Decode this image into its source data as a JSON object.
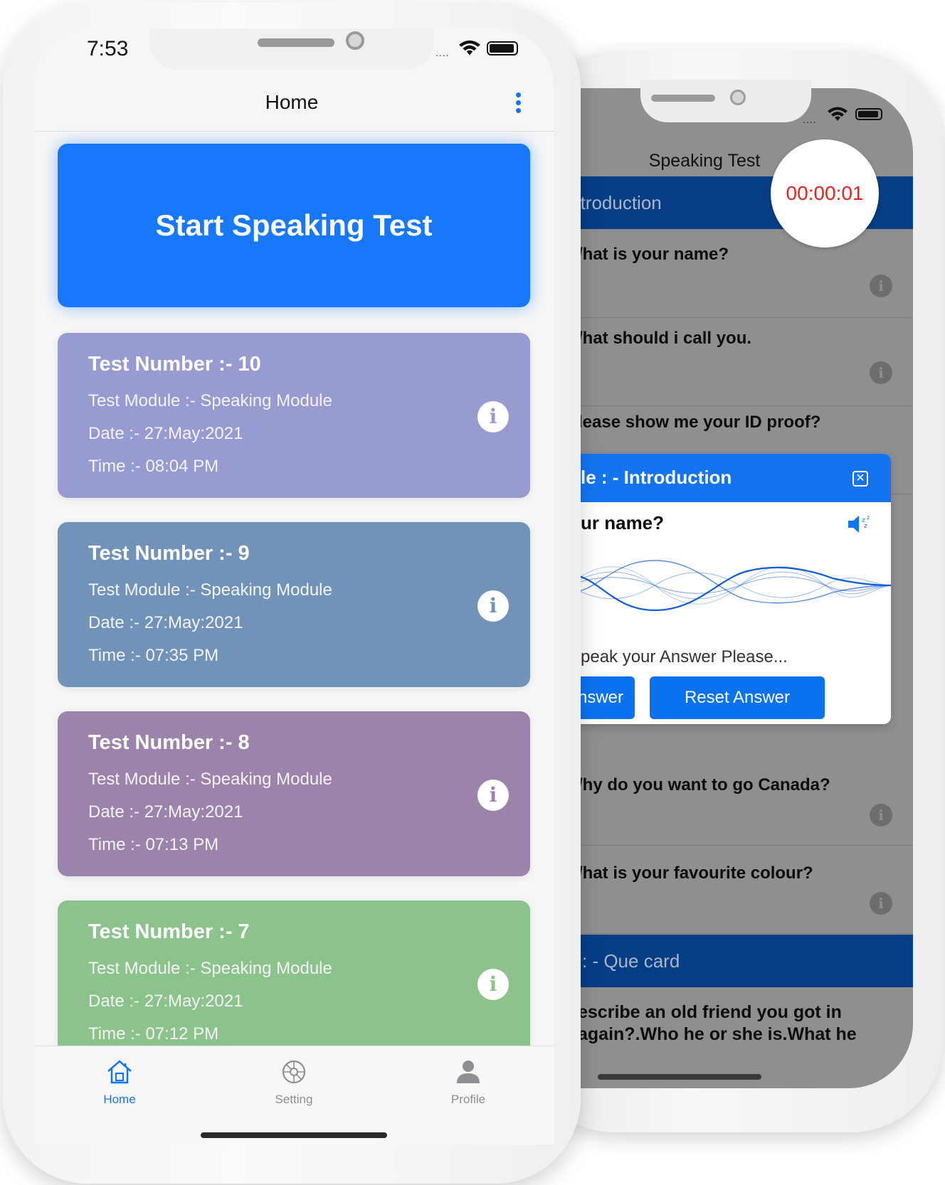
{
  "back_phone": {
    "title": "Speaking Test",
    "timer": "00:00:01",
    "sections": [
      {
        "label": "- Introduction"
      },
      {
        "label": ": - Que card"
      }
    ],
    "questions": [
      {
        "text": "/hat is your name?"
      },
      {
        "text": "/hat should i call you."
      },
      {
        "text": "lease show me your ID proof?"
      },
      {
        "text": "/hy do you want to go Canada?"
      },
      {
        "text": "/hat is your favourite colour?"
      }
    ],
    "long_question": "escribe an old friend you got in again?.Who he or she is.What he",
    "modal": {
      "title": "le : - Introduction",
      "question": "ur name?",
      "hint": "peak your Answer Please...",
      "answer_button": "Answer",
      "reset_button": "Reset Answer"
    }
  },
  "front_phone": {
    "status_time": "7:53",
    "nav_title": "Home",
    "start_button": "Start Speaking Test",
    "tests": [
      {
        "number": "Test Number :- 10",
        "module": "Test Module :- Speaking Module",
        "date": "Date :- 27:May:2021",
        "time": "Time :- 08:04 PM",
        "color": "#979bd1"
      },
      {
        "number": "Test Number :- 9",
        "module": "Test Module :- Speaking Module",
        "date": "Date :- 27:May:2021",
        "time": "Time :- 07:35 PM",
        "color": "#7193b9"
      },
      {
        "number": "Test Number :- 8",
        "module": "Test Module :- Speaking Module",
        "date": "Date :- 27:May:2021",
        "time": "Time :- 07:13 PM",
        "color": "#9c83ab"
      },
      {
        "number": "Test Number :- 7",
        "module": "Test Module :- Speaking Module",
        "date": "Date :- 27:May:2021",
        "time": "Time :- 07:12 PM",
        "color": "#8cc28b"
      }
    ],
    "tabs": [
      {
        "label": "Home",
        "icon": "home-icon",
        "active": true
      },
      {
        "label": "Setting",
        "icon": "gear-icon",
        "active": false
      },
      {
        "label": "Profile",
        "icon": "person-icon",
        "active": false
      }
    ],
    "colors": {
      "accent": "#1474ef",
      "inactive_tab": "#8e8e93"
    }
  }
}
